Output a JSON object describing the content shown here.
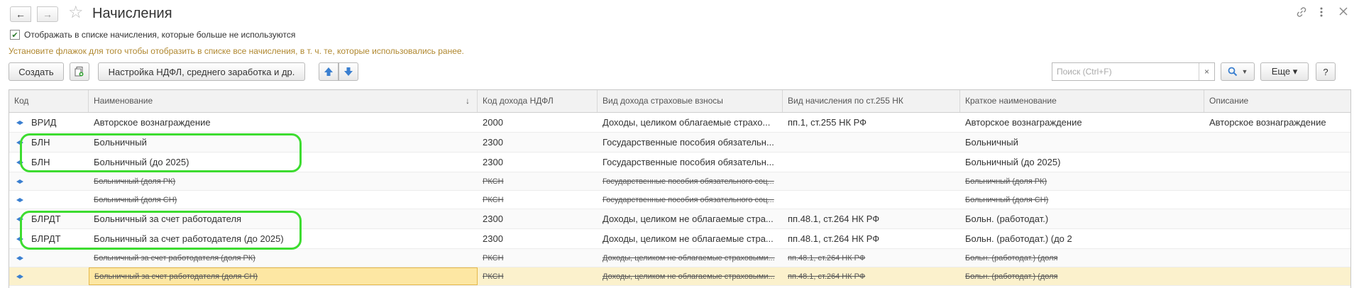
{
  "window": {
    "title": "Начисления",
    "nav_back": "←",
    "nav_forward": "→",
    "favorite_icon": "star-icon",
    "link_icon": "link-icon",
    "more_icon": "kebab-icon",
    "close_icon": "close-icon"
  },
  "filter": {
    "show_unused_checked": true,
    "show_unused_label": "Отображать в списке начисления, которые больше не используются",
    "hint": "Установите флажок для того чтобы отобразить в списке все начисления, в т. ч. те, которые использовались ранее."
  },
  "toolbar": {
    "create_label": "Создать",
    "ndfl_settings_label": "Настройка НДФЛ, среднего заработка и др.",
    "search_placeholder": "Поиск (Ctrl+F)",
    "search_clear": "×",
    "search_button": "🔍 ▾",
    "more_label": "Еще ▾",
    "help_label": "?"
  },
  "table": {
    "columns": [
      "Код",
      "Наименование",
      "Код дохода НДФЛ",
      "Вид дохода страховые взносы",
      "Вид начисления по ст.255 НК",
      "Краткое наименование",
      "Описание"
    ],
    "sort_indicator": "↓",
    "rows": [
      {
        "code": "ВРИД",
        "name": "Авторское вознаграждение",
        "ndfl": "2000",
        "insurance": "Доходы, целиком облагаемые страхо...",
        "nk255": "пп.1, ст.255 НК РФ",
        "short": "Авторское вознаграждение",
        "desc": "Авторское вознаграждение"
      },
      {
        "code": "БЛН",
        "name": "Больничный",
        "ndfl": "2300",
        "insurance": "Государственные пособия обязательн...",
        "nk255": "",
        "short": "Больничный",
        "desc": ""
      },
      {
        "code": "БЛН",
        "name": "Больничный (до 2025)",
        "ndfl": "2300",
        "insurance": "Государственные пособия обязательн...",
        "nk255": "",
        "short": "Больничный (до 2025)",
        "desc": ""
      },
      {
        "code": "",
        "name": "Больничный (доля РК)",
        "ndfl": "РКСН",
        "insurance": "Государственные пособия обязательного соц...",
        "nk255": "",
        "short": "Больничный (доля РК)",
        "desc": ""
      },
      {
        "code": "",
        "name": "Больничный (доля СН)",
        "ndfl": "РКСН",
        "insurance": "Государственные пособия обязательного соц...",
        "nk255": "",
        "short": "Больничный (доля СН)",
        "desc": ""
      },
      {
        "code": "БЛРДТ",
        "name": "Больничный за счет работодателя",
        "ndfl": "2300",
        "insurance": "Доходы, целиком не облагаемые стра...",
        "nk255": "пп.48.1, ст.264 НК РФ",
        "short": "Больн. (работодат.)",
        "desc": ""
      },
      {
        "code": "БЛРДТ",
        "name": "Больничный за счет работодателя (до 2025)",
        "ndfl": "2300",
        "insurance": "Доходы, целиком не облагаемые стра...",
        "nk255": "пп.48.1, ст.264 НК РФ",
        "short": "Больн. (работодат.) (до 2",
        "desc": ""
      },
      {
        "code": "",
        "name": "Больничный за счет работодателя (доля РК)",
        "ndfl": "РКСН",
        "insurance": "Доходы, целиком не облагаемые страховыми...",
        "nk255": "пп.48.1, ст.264 НК РФ",
        "short": "Больн. (работодат.) (доля",
        "desc": ""
      },
      {
        "code": "",
        "name": "Больничный за счет работодателя (доля СН)",
        "ndfl": "РКСН",
        "insurance": "Доходы, целиком не облагаемые страховыми...",
        "nk255": "пп.48.1, ст.264 НК РФ",
        "short": "Больн. (работодат.) (доля",
        "desc": ""
      }
    ]
  },
  "colors": {
    "annotation": "#3ddc30",
    "row_icon": "#3a7fd0",
    "selected_row": "#fbf1cc",
    "hint_text": "#b08830"
  }
}
